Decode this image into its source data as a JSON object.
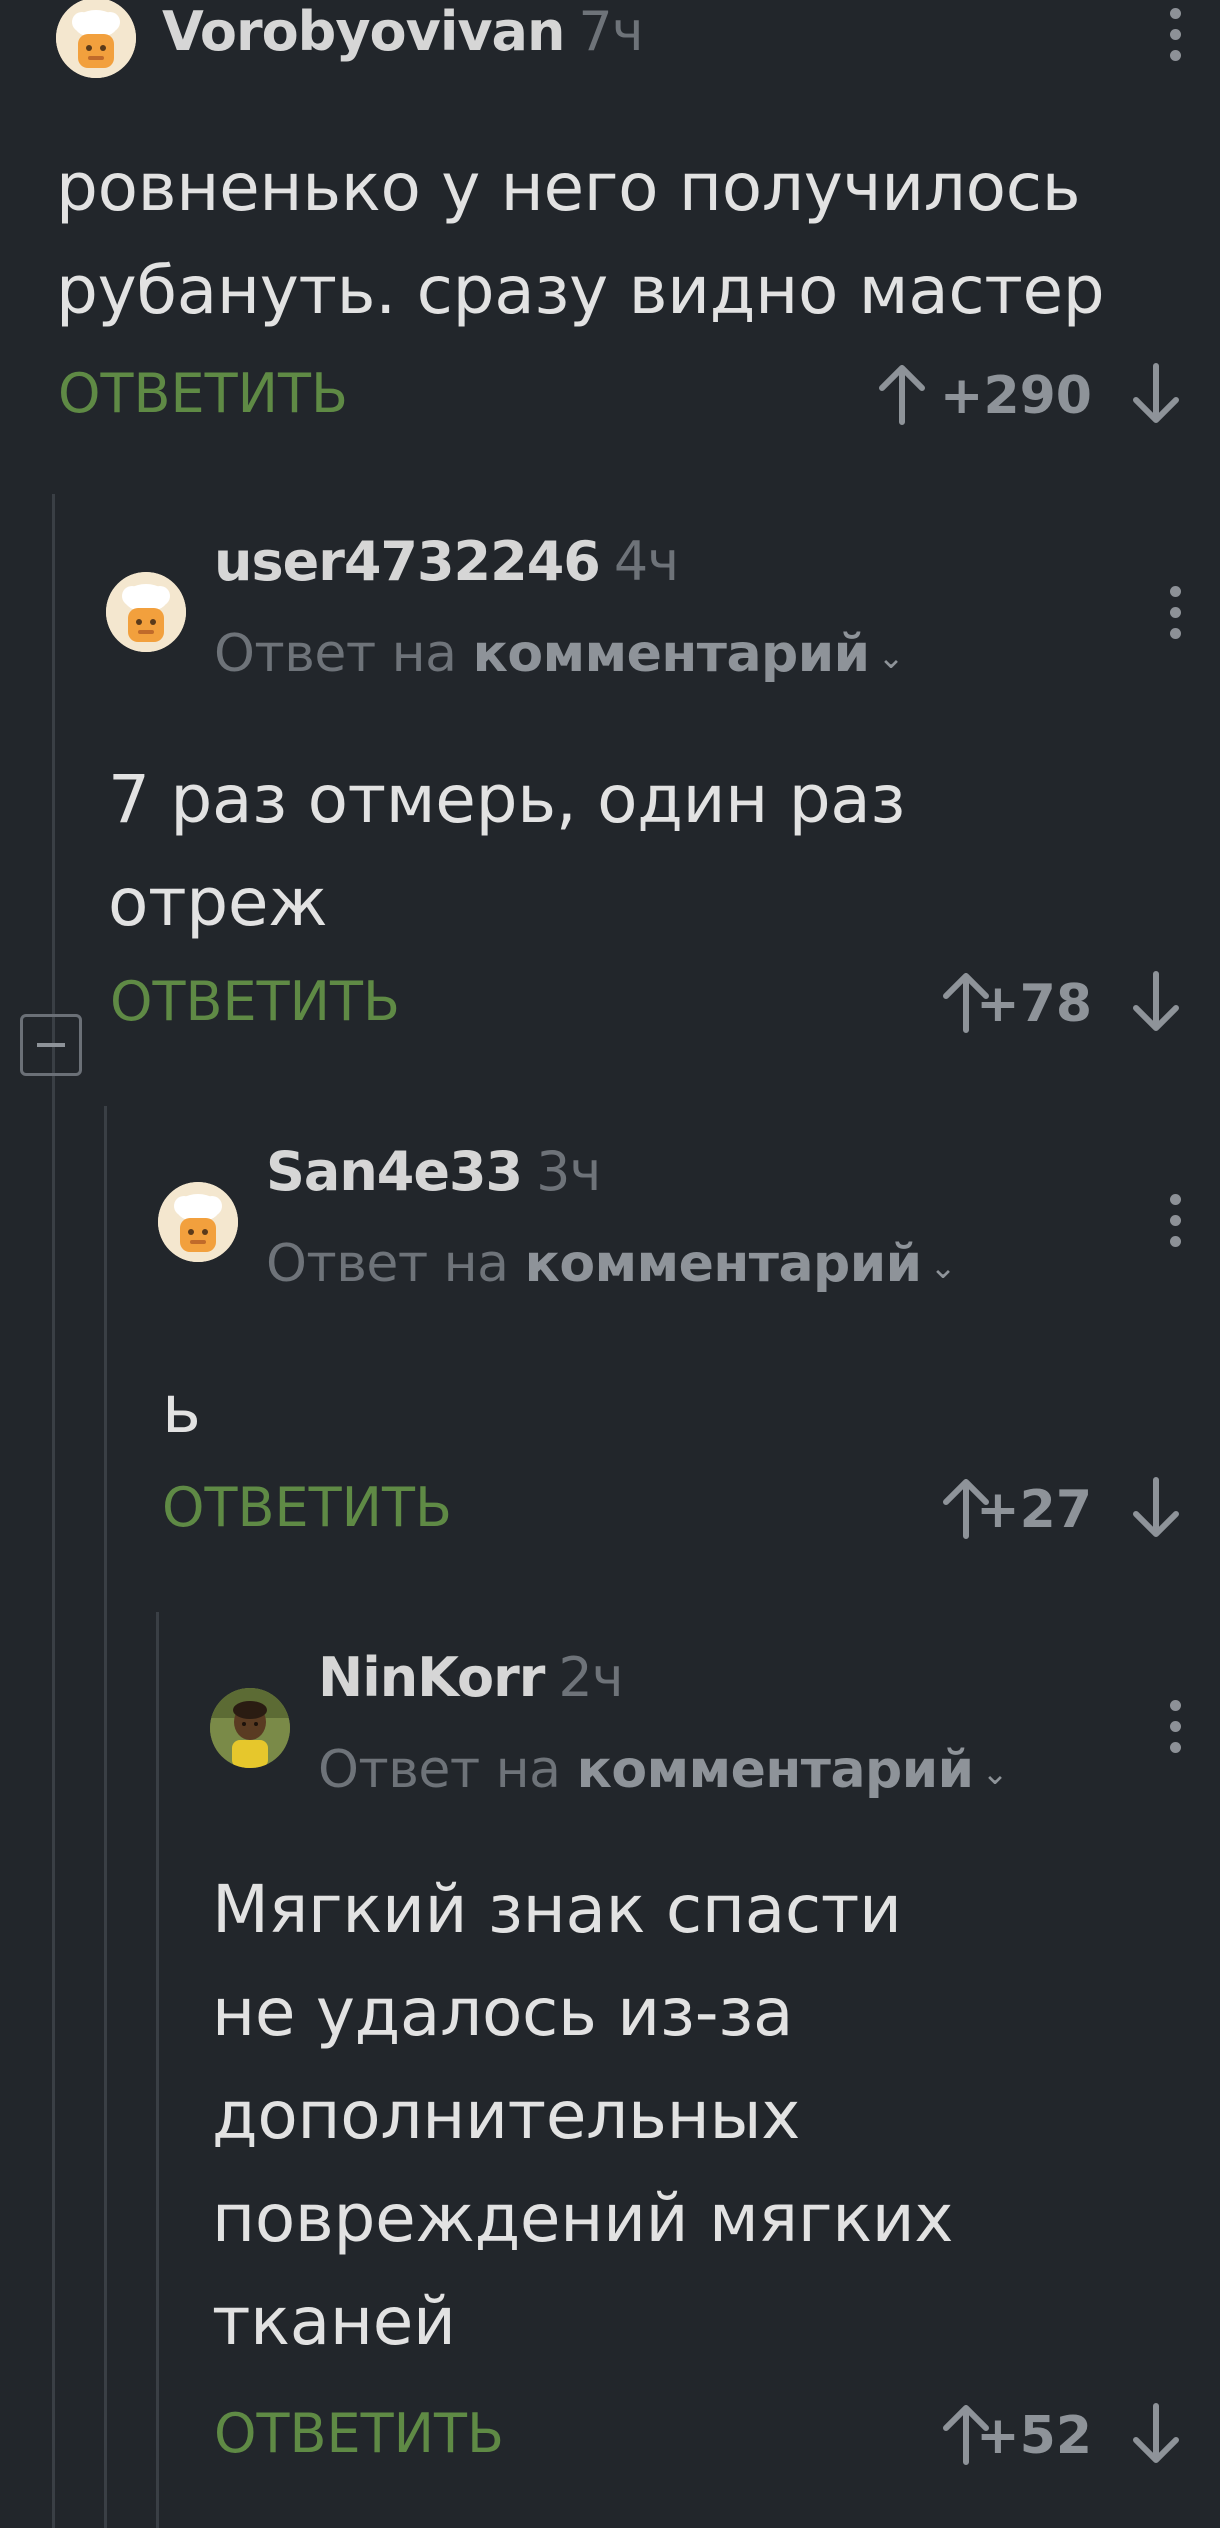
{
  "comments": [
    {
      "username": "Vorobyovivan",
      "time": "7ч",
      "reply_prefix": "",
      "reply_target": "",
      "text_lines": [
        "ровненько у него получилось",
        "рубануть. сразу видно мастер"
      ],
      "reply_label": "ОТВЕТИТЬ",
      "score": "+290",
      "avatar": "chef-avatar-icon"
    },
    {
      "username": "user4732246",
      "time": "4ч",
      "reply_prefix": "Ответ на",
      "reply_target": "комментарий",
      "text_lines": [
        "7 раз отмерь, один раз",
        "отреж"
      ],
      "reply_label": "ОТВЕТИТЬ",
      "score": "+78",
      "avatar": "chef-avatar-icon"
    },
    {
      "username": "San4e33",
      "time": "3ч",
      "reply_prefix": "Ответ на",
      "reply_target": "комментарий",
      "text_lines": [
        "ь"
      ],
      "reply_label": "ОТВЕТИТЬ",
      "score": "+27",
      "avatar": "chef-avatar-icon"
    },
    {
      "username": "NinKorr",
      "time": "2ч",
      "reply_prefix": "Ответ на",
      "reply_target": "комментарий",
      "text_lines": [
        "Мягкий знак спасти",
        "не удалось из-за",
        "дополнительных",
        "повреждений мягких",
        "тканей"
      ],
      "reply_label": "ОТВЕТИТЬ",
      "score": "+52",
      "avatar": "photo-avatar"
    }
  ],
  "colors": {
    "background": "#22262b",
    "reply_green": "#5f8a45",
    "muted": "#6e7379",
    "text": "#e2e2e2"
  }
}
